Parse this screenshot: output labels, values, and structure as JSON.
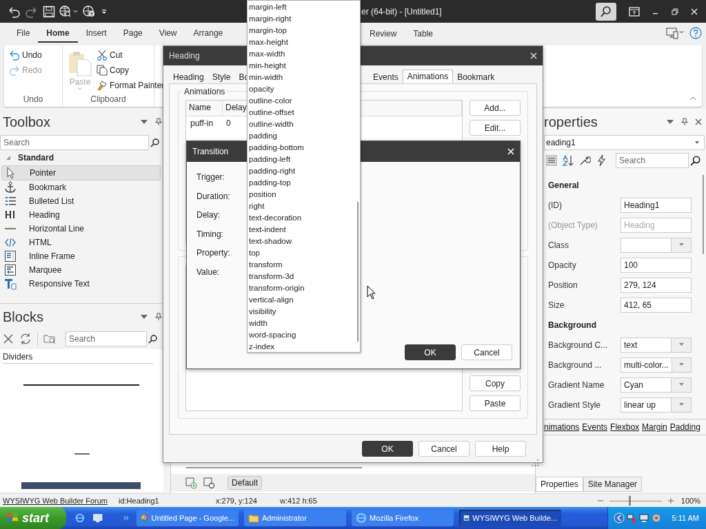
{
  "title_bar": {
    "title": "er (64-bit) - [Untitled1]"
  },
  "menu_tabs": [
    {
      "label": "File",
      "selected": false
    },
    {
      "label": "Home",
      "selected": true
    },
    {
      "label": "Insert",
      "selected": false
    },
    {
      "label": "Page",
      "selected": false
    },
    {
      "label": "View",
      "selected": false
    },
    {
      "label": "Arrange",
      "selected": false
    }
  ],
  "menu_tabs_right": [
    {
      "label": "Review",
      "selected": false
    },
    {
      "label": "Table",
      "selected": false
    }
  ],
  "ribbon": {
    "undo_group": {
      "label": "Undo",
      "items": [
        {
          "label": "Undo",
          "disabled": false
        },
        {
          "label": "Redo",
          "disabled": true
        }
      ]
    },
    "clipboard_group": {
      "label": "Clipboard",
      "paste": {
        "label": "Paste",
        "disabled": true
      },
      "items": [
        {
          "label": "Cut"
        },
        {
          "label": "Copy"
        },
        {
          "label": "Format Painter"
        }
      ]
    }
  },
  "toolbox": {
    "title": "Toolbox",
    "search": {
      "placeholder": "Search"
    },
    "group": {
      "label": "Standard",
      "expanded": true
    },
    "items": [
      {
        "label": "Pointer",
        "selected": true
      },
      {
        "label": "Bookmark",
        "selected": false
      },
      {
        "label": "Bulleted List",
        "selected": false
      },
      {
        "label": "Heading",
        "selected": false
      },
      {
        "label": "Horizontal Line",
        "selected": false
      },
      {
        "label": "HTML",
        "selected": false
      },
      {
        "label": "Inline Frame",
        "selected": false
      },
      {
        "label": "Marquee",
        "selected": false
      },
      {
        "label": "Responsive Text",
        "selected": false
      }
    ]
  },
  "blocks": {
    "title": "Blocks",
    "search": {
      "placeholder": "Search"
    },
    "category": "Dividers"
  },
  "canvas": {
    "style_button": "Default"
  },
  "properties": {
    "title": "roperties",
    "object": "eading1",
    "search": {
      "placeholder": "Search"
    },
    "rows": [
      {
        "kind": "section",
        "label": "General"
      },
      {
        "kind": "text",
        "label": "(ID)",
        "value": "Heading1",
        "disabled": false
      },
      {
        "kind": "text",
        "label": "(Object Type)",
        "value": "Heading",
        "disabled": true
      },
      {
        "kind": "combo",
        "label": "Class"
      },
      {
        "kind": "text",
        "label": "Opacity",
        "value": "100",
        "disabled": false
      },
      {
        "kind": "text",
        "label": "Position",
        "value": "279, 124",
        "disabled": false
      },
      {
        "kind": "text",
        "label": "Size",
        "value": "412, 65",
        "disabled": false
      },
      {
        "kind": "section",
        "label": "Background"
      },
      {
        "kind": "combo",
        "label": "Background C...",
        "value": "text"
      },
      {
        "kind": "combo",
        "label": "Background ...",
        "value": "multi-color..."
      },
      {
        "kind": "combo",
        "label": "Gradient Name",
        "value": "Cyan"
      },
      {
        "kind": "combo",
        "label": "Gradient Style",
        "value": "linear up"
      }
    ],
    "links": [
      "nimations",
      "Events",
      "Flexbox",
      "Margin",
      "Padding"
    ],
    "tabs": [
      {
        "label": "Properties",
        "selected": true
      },
      {
        "label": "Site Manager",
        "selected": false
      }
    ]
  },
  "status_bar": {
    "link": "WYSIWYG Web Builder Forum",
    "id": "id:Heading1",
    "position": "x:279, y:124",
    "size": "w:412 h:65",
    "zoom": {
      "level": 0.38,
      "reading": "100%"
    }
  },
  "heading_dialog": {
    "title": "Heading",
    "tabs": [
      {
        "label": "Heading",
        "selected": false
      },
      {
        "label": "Style",
        "selected": false
      },
      {
        "label": "Bo",
        "selected": false
      }
    ],
    "tabs_right": [
      {
        "label": "Events",
        "selected": false
      },
      {
        "label": "Animations",
        "selected": true
      },
      {
        "label": "Bookmark",
        "selected": false
      }
    ],
    "animations": {
      "label": "Animations",
      "columns": [
        "Name",
        "Delay"
      ],
      "rows": [
        [
          "puff-in",
          "0"
        ]
      ],
      "buttons": [
        "Add...",
        "Edit..."
      ]
    },
    "transitions": {
      "buttons": [
        "Copy",
        "Paste"
      ]
    },
    "buttons": [
      {
        "label": "OK",
        "kind": "primary"
      },
      {
        "label": "Cancel",
        "kind": "normal"
      },
      {
        "label": "Help",
        "kind": "normal"
      }
    ]
  },
  "transition_dialog": {
    "title": "Transition",
    "labels": [
      "Trigger:",
      "Duration:",
      "Delay:",
      "Timing:",
      "Property:",
      "Value:"
    ],
    "buttons": [
      {
        "label": "OK",
        "kind": "primary"
      },
      {
        "label": "Cancel",
        "kind": "normal"
      }
    ]
  },
  "property_list": {
    "items": [
      "margin-left",
      "margin-right",
      "margin-top",
      "max-height",
      "max-width",
      "min-height",
      "min-width",
      "opacity",
      "outline-color",
      "outline-offset",
      "outline-width",
      "padding",
      "padding-bottom",
      "padding-left",
      "padding-right",
      "padding-top",
      "position",
      "right",
      "text-decoration",
      "text-indent",
      "text-shadow",
      "top",
      "transform",
      "transform-3d",
      "transform-origin",
      "vertical-align",
      "visibility",
      "width",
      "word-spacing",
      "z-index"
    ]
  },
  "taskbar": {
    "start": "start",
    "tasks": [
      {
        "label": "Untitled Page - Google...",
        "selected": false
      },
      {
        "label": "Administrator",
        "selected": false
      },
      {
        "label": "Mozilla Firefox",
        "selected": false
      },
      {
        "label": "WYSIWYG Web Builde...",
        "selected": true
      }
    ],
    "clock": "5:11 AM"
  }
}
